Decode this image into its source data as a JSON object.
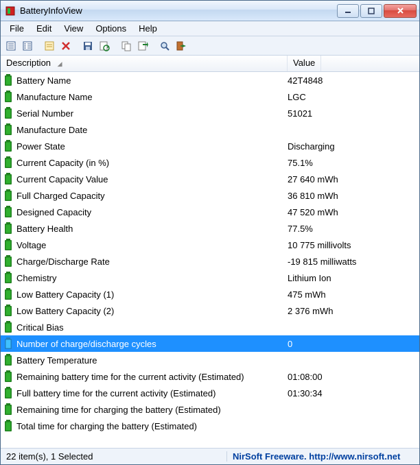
{
  "window": {
    "title": "BatteryInfoView"
  },
  "menus": [
    "File",
    "Edit",
    "View",
    "Options",
    "Help"
  ],
  "columns": {
    "description": "Description",
    "value": "Value"
  },
  "rows": [
    {
      "desc": "Battery Name",
      "val": "42T4848",
      "selected": false
    },
    {
      "desc": "Manufacture Name",
      "val": "LGC",
      "selected": false
    },
    {
      "desc": "Serial Number",
      "val": "51021",
      "selected": false
    },
    {
      "desc": "Manufacture Date",
      "val": "",
      "selected": false
    },
    {
      "desc": "Power State",
      "val": "Discharging",
      "selected": false
    },
    {
      "desc": "Current Capacity (in %)",
      "val": "75.1%",
      "selected": false
    },
    {
      "desc": "Current Capacity Value",
      "val": "27 640 mWh",
      "selected": false
    },
    {
      "desc": "Full Charged Capacity",
      "val": "36 810 mWh",
      "selected": false
    },
    {
      "desc": "Designed Capacity",
      "val": "47 520 mWh",
      "selected": false
    },
    {
      "desc": "Battery Health",
      "val": "77.5%",
      "selected": false
    },
    {
      "desc": "Voltage",
      "val": "10 775 millivolts",
      "selected": false
    },
    {
      "desc": "Charge/Discharge Rate",
      "val": "-19 815 milliwatts",
      "selected": false
    },
    {
      "desc": "Chemistry",
      "val": "Lithium Ion",
      "selected": false
    },
    {
      "desc": "Low Battery Capacity (1)",
      "val": "475 mWh",
      "selected": false
    },
    {
      "desc": "Low Battery Capacity (2)",
      "val": "2 376 mWh",
      "selected": false
    },
    {
      "desc": "Critical Bias",
      "val": "",
      "selected": false
    },
    {
      "desc": "Number of charge/discharge cycles",
      "val": "0",
      "selected": true
    },
    {
      "desc": "Battery Temperature",
      "val": "",
      "selected": false
    },
    {
      "desc": "Remaining battery time for the current activity (Estimated)",
      "val": "01:08:00",
      "selected": false
    },
    {
      "desc": "Full battery time for the current activity (Estimated)",
      "val": "01:30:34",
      "selected": false
    },
    {
      "desc": "Remaining time for charging the battery (Estimated)",
      "val": "",
      "selected": false
    },
    {
      "desc": "Total  time for charging the battery (Estimated)",
      "val": "",
      "selected": false
    }
  ],
  "statusbar": {
    "left": "22 item(s), 1 Selected",
    "right": "NirSoft Freeware.  http://www.nirsoft.net"
  }
}
